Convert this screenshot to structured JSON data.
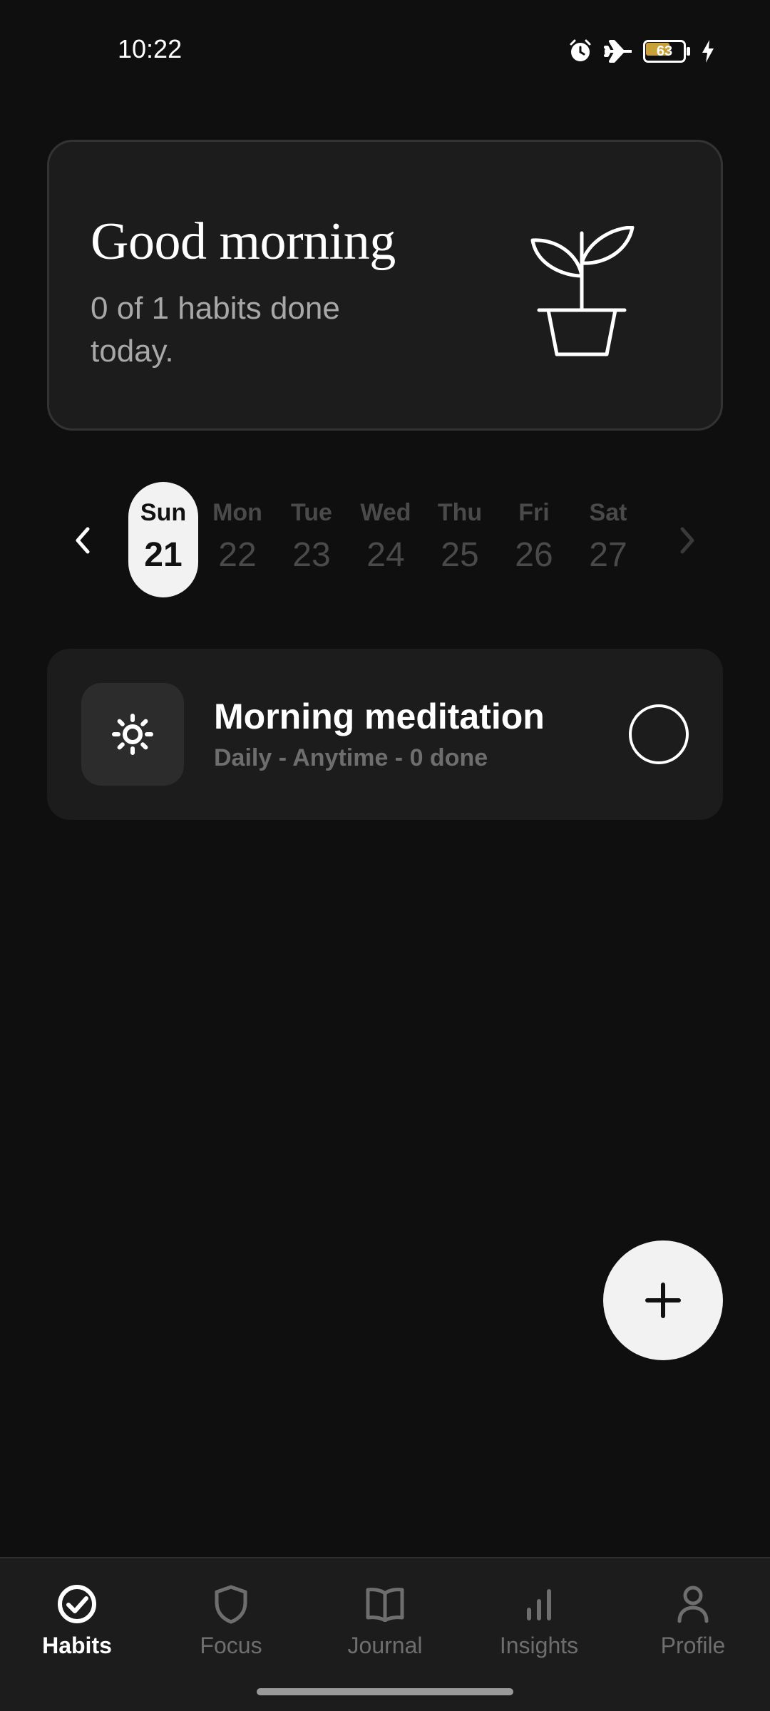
{
  "status_bar": {
    "time": "10:22",
    "battery_level": "63",
    "battery_fraction": 0.63,
    "icons": [
      "alarm-icon",
      "airplane-mode-icon",
      "battery-icon",
      "charging-bolt-icon"
    ]
  },
  "greeting": {
    "title": "Good morning",
    "subtitle": "0 of 1 habits done today.",
    "icon": "plant-icon"
  },
  "week": {
    "prev_icon": "chevron-left-icon",
    "next_icon": "chevron-right-icon",
    "days": [
      {
        "name": "Sun",
        "num": "21",
        "selected": true
      },
      {
        "name": "Mon",
        "num": "22",
        "selected": false
      },
      {
        "name": "Tue",
        "num": "23",
        "selected": false
      },
      {
        "name": "Wed",
        "num": "24",
        "selected": false
      },
      {
        "name": "Thu",
        "num": "25",
        "selected": false
      },
      {
        "name": "Fri",
        "num": "26",
        "selected": false
      },
      {
        "name": "Sat",
        "num": "27",
        "selected": false
      }
    ]
  },
  "habits": [
    {
      "title": "Morning meditation",
      "meta": "Daily - Anytime - 0 done",
      "icon": "sun-icon",
      "completed": false
    }
  ],
  "fab": {
    "icon": "plus-icon"
  },
  "bottom_nav": {
    "items": [
      {
        "label": "Habits",
        "icon": "check-circle-icon",
        "active": true
      },
      {
        "label": "Focus",
        "icon": "shield-icon",
        "active": false
      },
      {
        "label": "Journal",
        "icon": "book-icon",
        "active": false
      },
      {
        "label": "Insights",
        "icon": "bar-chart-icon",
        "active": false
      },
      {
        "label": "Profile",
        "icon": "person-icon",
        "active": false
      }
    ]
  },
  "colors": {
    "background": "#0f0f0f",
    "card": "#1c1c1c",
    "accent": "#f2f2f2",
    "muted_text": "#6e6e6e",
    "battery_fill": "#c9a13a"
  }
}
